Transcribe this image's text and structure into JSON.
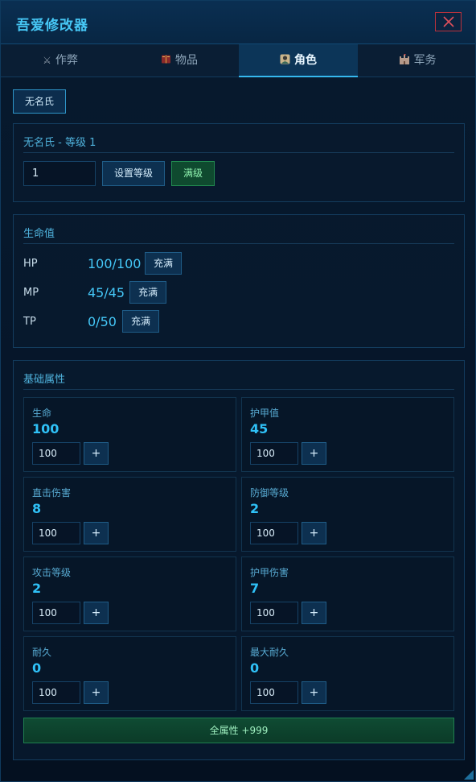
{
  "window": {
    "title": "吾爱修改器"
  },
  "tabs": [
    {
      "label": "作弊",
      "icon": "crossed-swords-icon"
    },
    {
      "label": "物品",
      "icon": "spellbook-icon"
    },
    {
      "label": "角色",
      "icon": "character-portrait-icon"
    },
    {
      "label": "军务",
      "icon": "castle-icon"
    }
  ],
  "active_tab": "角色",
  "character": {
    "chip_label": "无名氏"
  },
  "level_panel": {
    "header": "无名氏 - 等级 1",
    "input_value": "1",
    "set_level_label": "设置等级",
    "max_level_label": "满级"
  },
  "vitals": {
    "header": "生命值",
    "items": [
      {
        "label": "HP",
        "value": "100/100",
        "button": "充满"
      },
      {
        "label": "MP",
        "value": "45/45",
        "button": "充满"
      },
      {
        "label": "TP",
        "value": "0/50",
        "button": "充满"
      }
    ]
  },
  "attributes": {
    "header": "基础属性",
    "items": [
      {
        "name": "生命",
        "value": "100",
        "input": "100",
        "plus": "+"
      },
      {
        "name": "护甲值",
        "value": "45",
        "input": "100",
        "plus": "+"
      },
      {
        "name": "直击伤害",
        "value": "8",
        "input": "100",
        "plus": "+"
      },
      {
        "name": "防御等级",
        "value": "2",
        "input": "100",
        "plus": "+"
      },
      {
        "name": "攻击等级",
        "value": "2",
        "input": "100",
        "plus": "+"
      },
      {
        "name": "护甲伤害",
        "value": "7",
        "input": "100",
        "plus": "+"
      },
      {
        "name": "耐久",
        "value": "0",
        "input": "100",
        "plus": "+"
      },
      {
        "name": "最大耐久",
        "value": "0",
        "input": "100",
        "plus": "+"
      }
    ],
    "all_button": "全属性 +999"
  },
  "colors": {
    "accent": "#35b8ee",
    "close_border": "#b8323d",
    "green": "#218a50"
  }
}
